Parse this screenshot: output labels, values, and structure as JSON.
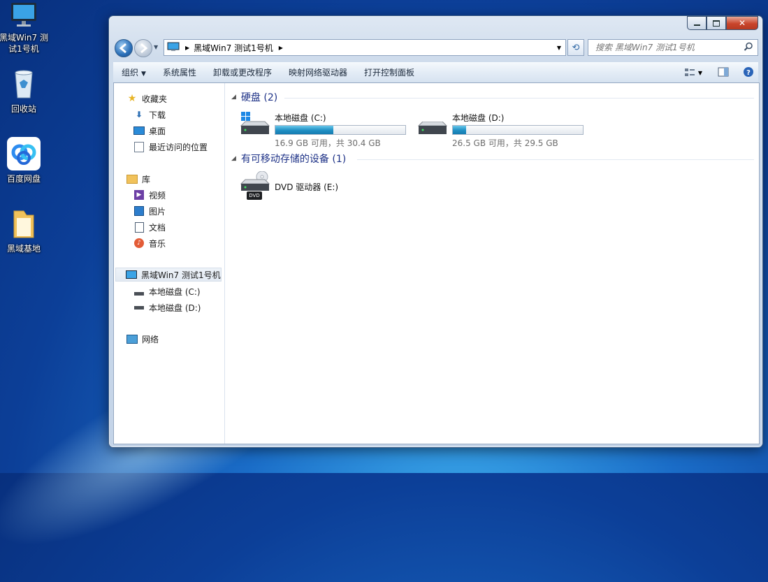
{
  "desktop": {
    "icons": [
      {
        "label": "黑域Win7 测试1号机",
        "icon": "computer-icon"
      },
      {
        "label": "回收站",
        "icon": "recycle-bin-icon"
      },
      {
        "label": "百度网盘",
        "icon": "baidu-netdisk-icon"
      },
      {
        "label": "黑域基地",
        "icon": "folder-icon"
      }
    ]
  },
  "window": {
    "address": {
      "segments": [
        "黑域Win7 测试1号机"
      ]
    },
    "search": {
      "placeholder": "搜索 黑域Win7 测试1号机"
    },
    "toolbar": {
      "organize": "组织",
      "items": [
        "系统属性",
        "卸载或更改程序",
        "映射网络驱动器",
        "打开控制面板"
      ]
    },
    "nav": {
      "favorites": {
        "label": "收藏夹",
        "items": [
          "下载",
          "桌面",
          "最近访问的位置"
        ]
      },
      "libraries": {
        "label": "库",
        "items": [
          "视频",
          "图片",
          "文档",
          "音乐"
        ]
      },
      "computer": {
        "label": "黑域Win7 测试1号机",
        "items": [
          "本地磁盘 (C:)",
          "本地磁盘 (D:)"
        ]
      },
      "network": {
        "label": "网络"
      }
    },
    "groups": {
      "hard_disks": {
        "title": "硬盘 (2)"
      },
      "removable": {
        "title": "有可移动存储的设备 (1)"
      }
    },
    "drives": [
      {
        "name": "本地磁盘 (C:)",
        "free_text": "16.9 GB 可用，共 30.4 GB",
        "used_fraction": 0.444
      },
      {
        "name": "本地磁盘 (D:)",
        "free_text": "26.5 GB 可用，共 29.5 GB",
        "used_fraction": 0.102
      }
    ],
    "dvd": {
      "name": "DVD 驱动器 (E:)",
      "badge": "DVD"
    }
  }
}
